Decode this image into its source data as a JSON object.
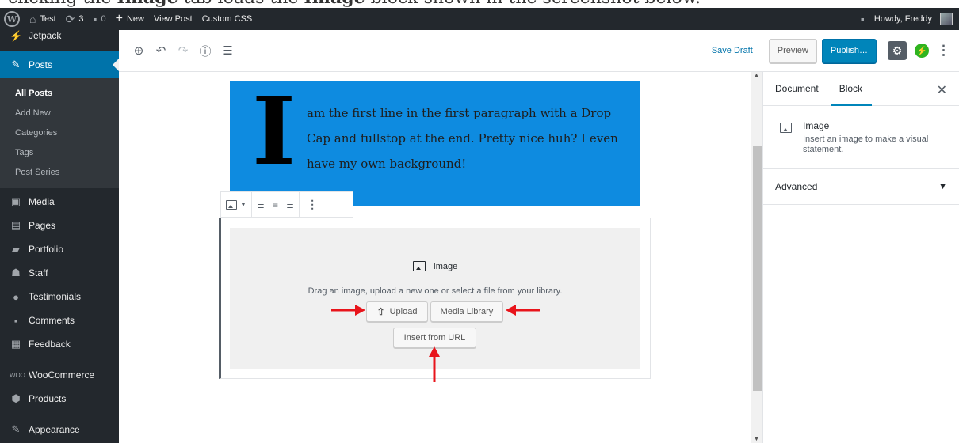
{
  "caption": {
    "before": "clicking the ",
    "bold1": "Image",
    "middle": " tab loads the ",
    "bold2": "Image",
    "after": " block shown in the screenshot below."
  },
  "adminbar": {
    "site_name": "Test",
    "updates_count": "3",
    "comments_count": "0",
    "new_label": "New",
    "view_post": "View Post",
    "custom_css": "Custom CSS",
    "howdy": "Howdy, Freddy"
  },
  "sidebar": {
    "jetpack": "Jetpack",
    "posts": "Posts",
    "submenu": [
      "All Posts",
      "Add New",
      "Categories",
      "Tags",
      "Post Series"
    ],
    "items": [
      "Media",
      "Pages",
      "Portfolio",
      "Staff",
      "Testimonials",
      "Comments",
      "Feedback"
    ],
    "items2": [
      "WooCommerce",
      "Products"
    ],
    "appearance": "Appearance"
  },
  "toolbar": {
    "save_draft": "Save Draft",
    "preview": "Preview",
    "publish": "Publish…"
  },
  "cover": {
    "dropcap": "I",
    "text": "am the first line in the first paragraph with a Drop Cap and fullstop at the end. Pretty nice huh? I even have my own background!"
  },
  "image_block": {
    "label": "Image",
    "instructions": "Drag an image, upload a new one or select a file from your library.",
    "upload": "Upload",
    "media_library": "Media Library",
    "insert_url": "Insert from URL"
  },
  "settings": {
    "tab_document": "Document",
    "tab_block": "Block",
    "block_title": "Image",
    "block_desc": "Insert an image to make a visual statement.",
    "advanced": "Advanced"
  },
  "colors": {
    "admin_dark": "#23282d",
    "accent": "#0073aa",
    "cover_bg": "#0e8be0",
    "arrow": "#e8141b"
  }
}
